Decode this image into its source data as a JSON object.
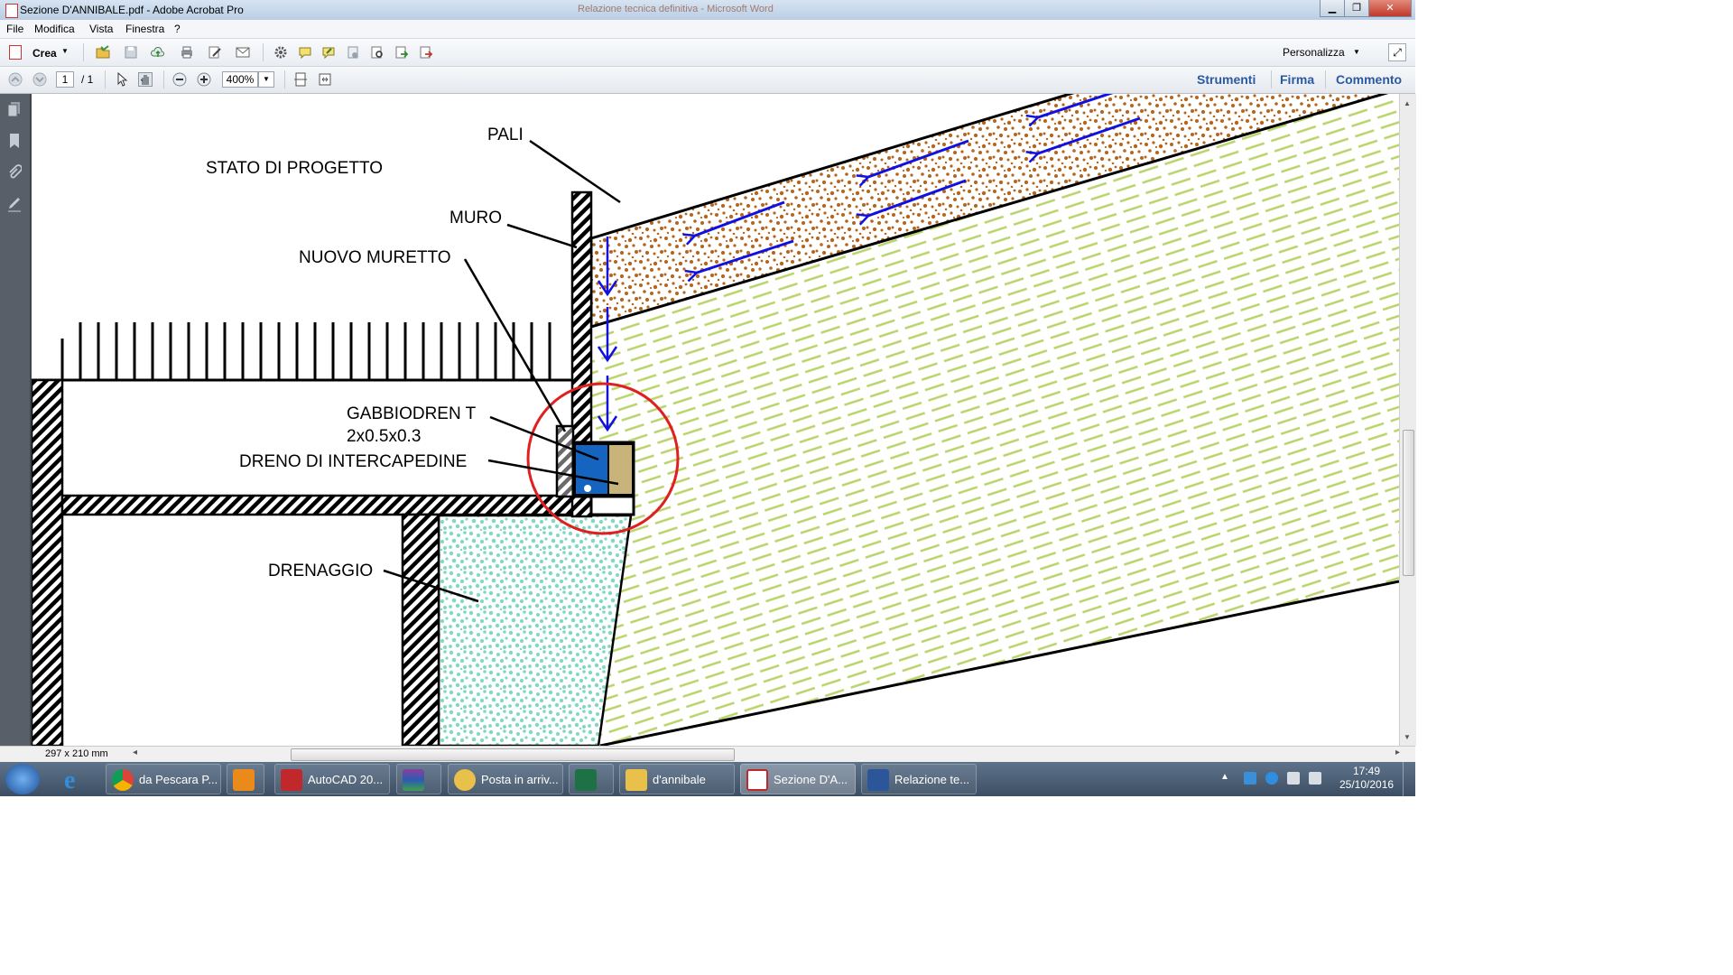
{
  "window": {
    "title": "Sezione D'ANNIBALE.pdf - Adobe Acrobat Pro",
    "background_title": "Relazione tecnica definitiva - Microsoft Word",
    "minimize": "▁",
    "maximize": "❐",
    "close": "✕"
  },
  "menu": [
    "File",
    "Modifica",
    "Vista",
    "Finestra",
    "?"
  ],
  "toolbar": {
    "crea_label": "Crea",
    "personalizza_label": "Personalizza"
  },
  "nav": {
    "page_current": "1",
    "page_total": "/ 1",
    "zoom": "400%",
    "panels": [
      "Strumenti",
      "Firma",
      "Commento"
    ]
  },
  "drawing": {
    "title": "STATO DI PROGETTO",
    "labels": {
      "pali": "PALI",
      "muro": "MURO",
      "nuovo_muretto": "NUOVO MURETTO",
      "gabbiodren_line1": "GABBIODREN T",
      "gabbiodren_line2": "2x0.5x0.3",
      "dreno": "DRENO DI INTERCAPEDINE",
      "drenaggio": "DRENAGGIO"
    },
    "colors": {
      "gravel": "#b5651d",
      "arrows": "#1010e0",
      "soil_lines": "#b9d46a",
      "drainage": "#7fd9c0",
      "highlight_circle": "#e02020",
      "gabbiodren_blue": "#1565c0",
      "gabbiodren_sand": "#c8b47a"
    }
  },
  "status": {
    "page_size": "297 x 210 mm"
  },
  "taskbar": {
    "items": [
      {
        "label": "da Pescara P...",
        "icon": "chrome-icon"
      },
      {
        "label": "",
        "icon": "media-player-icon"
      },
      {
        "label": "AutoCAD 20...",
        "icon": "autocad-icon"
      },
      {
        "label": "",
        "icon": "winrar-icon"
      },
      {
        "label": "Posta in arriv...",
        "icon": "outlook-icon"
      },
      {
        "label": "",
        "icon": "excel-icon"
      },
      {
        "label": "d'annibale",
        "icon": "folder-icon"
      },
      {
        "label": "Sezione D'A...",
        "icon": "acrobat-icon"
      },
      {
        "label": "Relazione te...",
        "icon": "word-icon"
      }
    ],
    "time": "17:49",
    "date": "25/10/2016"
  }
}
